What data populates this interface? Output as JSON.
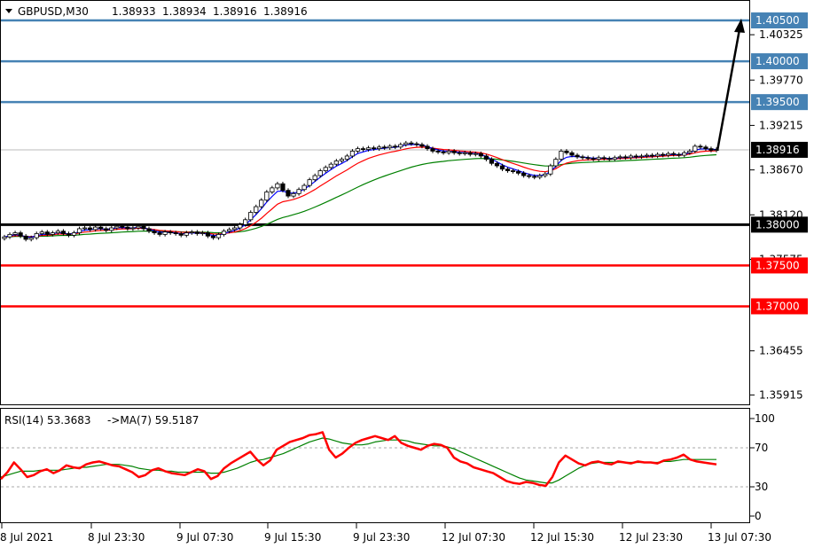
{
  "header": {
    "symbol": "GBPUSD,M30",
    "open": "1.38933",
    "high": "1.38934",
    "low": "1.38916",
    "close": "1.38916"
  },
  "rsi_header": {
    "rsi_label": "RSI(14) 53.3683",
    "ma_label": "->MA(7) 59.5187"
  },
  "colors": {
    "blue_level": "#4682B4",
    "black_level": "#000000",
    "red_level": "#FF0000",
    "ma_fast": "#0000FF",
    "ma_mid": "#FF0000",
    "ma_slow": "#008000",
    "rsi_line": "#FF0000",
    "rsi_ma": "#008000"
  },
  "chart_data": [
    {
      "type": "line",
      "title": "GBPUSD,M30",
      "price_axis_ticks": [
        "1.40325",
        "1.39770",
        "1.39215",
        "1.38670",
        "1.38120",
        "1.37575",
        "1.36455",
        "1.35915"
      ],
      "price_range": [
        1.358,
        1.4075
      ],
      "time_ticks": [
        "8 Jul 2021",
        "8 Jul 23:30",
        "9 Jul 07:30",
        "9 Jul 15:30",
        "9 Jul 23:30",
        "12 Jul 07:30",
        "12 Jul 15:30",
        "12 Jul 23:30",
        "13 Jul 07:30"
      ],
      "levels": [
        {
          "price": "1.40500",
          "value": 1.405,
          "color": "blue"
        },
        {
          "price": "1.40000",
          "value": 1.4,
          "color": "blue"
        },
        {
          "price": "1.39500",
          "value": 1.395,
          "color": "blue"
        },
        {
          "price": "1.38000",
          "value": 1.38,
          "color": "black"
        },
        {
          "price": "1.37500",
          "value": 1.375,
          "color": "red"
        },
        {
          "price": "1.37000",
          "value": 1.37,
          "color": "red"
        }
      ],
      "current_price": "1.38916",
      "current_value": 1.38916,
      "close_series": [
        1.3785,
        1.3788,
        1.379,
        1.3786,
        1.3782,
        1.3784,
        1.3789,
        1.3791,
        1.3788,
        1.379,
        1.3792,
        1.3789,
        1.3787,
        1.379,
        1.3795,
        1.3796,
        1.3794,
        1.3797,
        1.3795,
        1.3793,
        1.3796,
        1.3798,
        1.3797,
        1.3795,
        1.3796,
        1.3798,
        1.3795,
        1.3792,
        1.379,
        1.3788,
        1.3791,
        1.379,
        1.3789,
        1.3787,
        1.379,
        1.3791,
        1.3789,
        1.379,
        1.3786,
        1.3784,
        1.3788,
        1.3792,
        1.3794,
        1.3796,
        1.38,
        1.3806,
        1.3815,
        1.3822,
        1.383,
        1.384,
        1.3845,
        1.385,
        1.3842,
        1.3835,
        1.3838,
        1.3843,
        1.3848,
        1.3855,
        1.386,
        1.3866,
        1.387,
        1.3874,
        1.3878,
        1.388,
        1.3884,
        1.389,
        1.3893,
        1.3892,
        1.3894,
        1.3893,
        1.3895,
        1.3894,
        1.3896,
        1.3895,
        1.3898,
        1.39,
        1.3899,
        1.3898,
        1.3896,
        1.3893,
        1.389,
        1.3889,
        1.3888,
        1.389,
        1.3888,
        1.3887,
        1.3888,
        1.3886,
        1.3887,
        1.3884,
        1.388,
        1.3875,
        1.3872,
        1.3868,
        1.3866,
        1.3865,
        1.3863,
        1.386,
        1.3859,
        1.3858,
        1.386,
        1.3862,
        1.3872,
        1.388,
        1.389,
        1.3888,
        1.3885,
        1.3883,
        1.3882,
        1.3881,
        1.388,
        1.3882,
        1.3881,
        1.388,
        1.3882,
        1.3883,
        1.3882,
        1.3884,
        1.3883,
        1.3884,
        1.3885,
        1.3884,
        1.3886,
        1.3885,
        1.3887,
        1.3886,
        1.3885,
        1.3888,
        1.389,
        1.3896,
        1.3895,
        1.3893,
        1.3891,
        1.3892
      ]
    },
    {
      "type": "line",
      "title": "RSI(14)",
      "y_ticks": [
        "100",
        "70",
        "30",
        "0"
      ],
      "ylim": [
        0,
        100
      ],
      "levels": [
        70,
        30
      ],
      "series": [
        {
          "name": "RSI(14) 53.3683",
          "values": [
            38,
            45,
            55,
            48,
            40,
            42,
            46,
            48,
            44,
            47,
            52,
            50,
            49,
            53,
            55,
            56,
            54,
            52,
            51,
            48,
            45,
            40,
            42,
            47,
            49,
            46,
            44,
            43,
            42,
            45,
            48,
            46,
            38,
            41,
            49,
            54,
            58,
            62,
            66,
            58,
            52,
            57,
            68,
            72,
            76,
            78,
            80,
            83,
            84,
            86,
            68,
            60,
            64,
            70,
            75,
            78,
            80,
            82,
            80,
            78,
            82,
            75,
            72,
            70,
            68,
            72,
            74,
            73,
            70,
            60,
            56,
            54,
            50,
            48,
            46,
            44,
            40,
            36,
            34,
            33,
            35,
            34,
            32,
            31,
            40,
            55,
            62,
            58,
            54,
            52,
            55,
            56,
            54,
            53,
            56,
            55,
            54,
            56,
            55,
            55,
            54,
            57,
            58,
            60,
            63,
            58,
            56,
            55,
            54,
            53
          ]
        },
        {
          "name": "MA(7) 59.5187",
          "values": [
            40,
            42,
            44,
            46,
            46,
            46,
            47,
            47,
            47,
            47,
            48,
            49,
            50,
            50,
            51,
            52,
            53,
            53,
            53,
            52,
            51,
            49,
            48,
            47,
            47,
            46,
            46,
            45,
            45,
            45,
            45,
            45,
            44,
            44,
            45,
            47,
            49,
            52,
            55,
            57,
            58,
            60,
            62,
            64,
            67,
            70,
            73,
            76,
            78,
            80,
            79,
            77,
            75,
            74,
            73,
            73,
            74,
            76,
            77,
            78,
            78,
            78,
            77,
            75,
            74,
            73,
            72,
            72,
            71,
            69,
            66,
            63,
            60,
            57,
            54,
            51,
            48,
            45,
            42,
            39,
            37,
            36,
            35,
            34,
            34,
            37,
            41,
            45,
            49,
            52,
            54,
            55,
            55,
            55,
            55,
            55,
            55,
            55,
            55,
            55,
            55,
            56,
            56,
            57,
            58,
            58,
            58,
            58,
            58,
            58
          ]
        }
      ]
    }
  ]
}
